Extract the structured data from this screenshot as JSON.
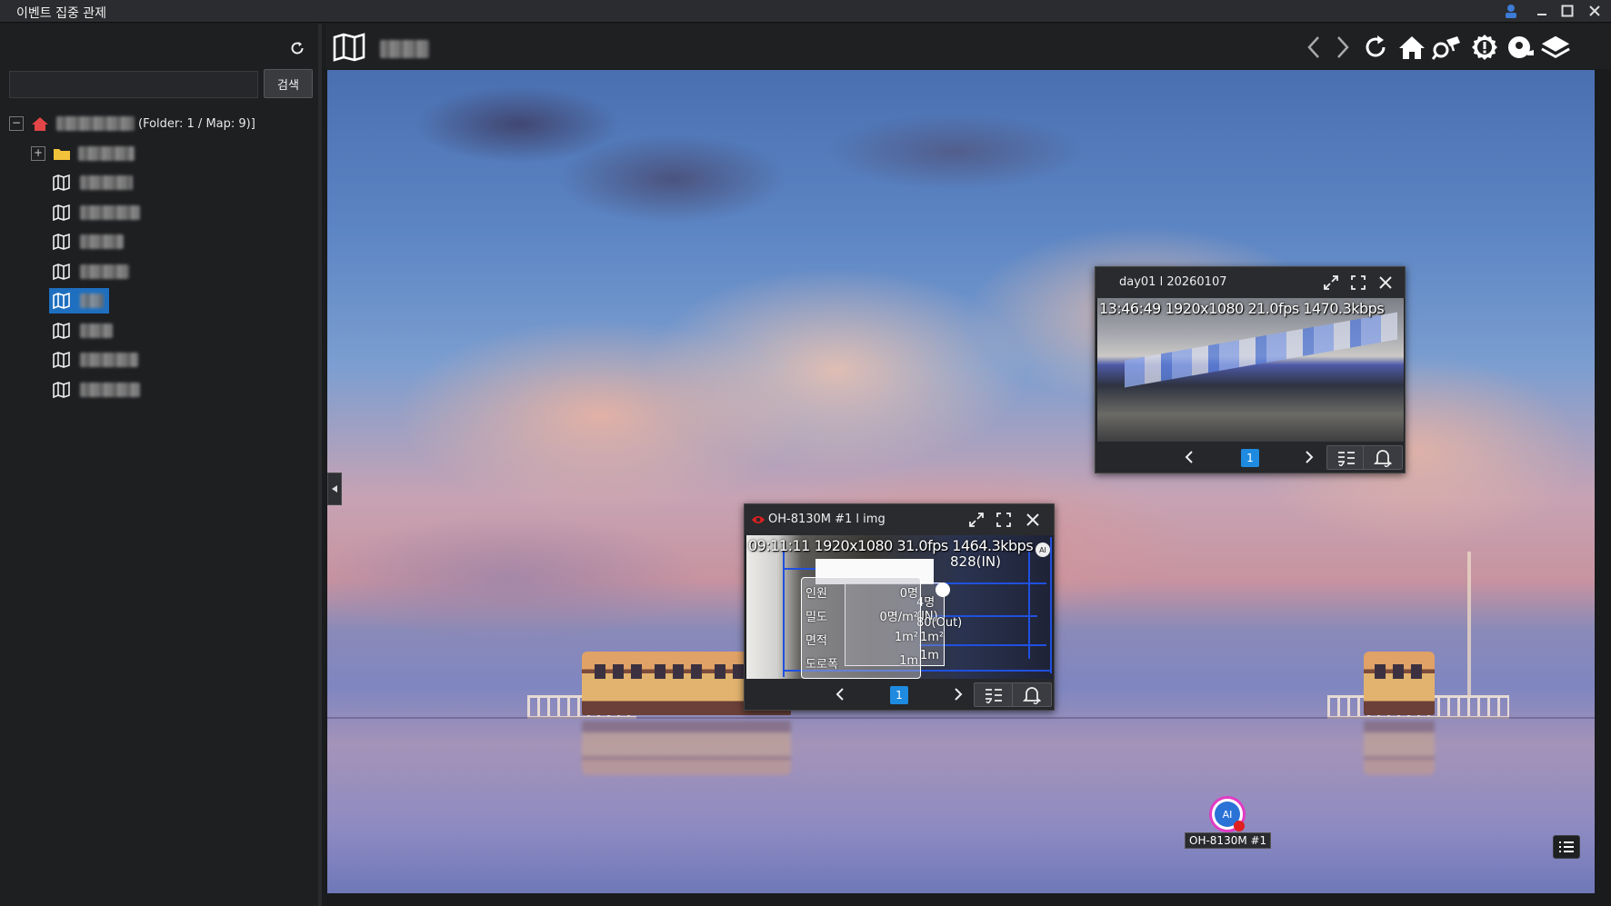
{
  "window": {
    "title": "이벤트 집중 관제"
  },
  "sidebar": {
    "search_placeholder": "",
    "search_button": "검색",
    "tree_root_suffix": "(Folder: 1 / Map: 9)]",
    "tree_items": [
      {
        "type": "site"
      },
      {
        "type": "folder"
      },
      {
        "type": "map"
      },
      {
        "type": "map"
      },
      {
        "type": "map"
      },
      {
        "type": "map"
      },
      {
        "type": "map",
        "selected": true
      },
      {
        "type": "map"
      },
      {
        "type": "map"
      },
      {
        "type": "map"
      }
    ]
  },
  "toolbar": {
    "icons": [
      "back-icon",
      "forward-icon",
      "refresh-icon",
      "home-icon",
      "search-camera-icon",
      "alert-icon",
      "camera-settings-icon",
      "layers-icon"
    ]
  },
  "popups": [
    {
      "title": "day01 l 20260107",
      "overlay": "13:46:49 1920x1080 21.0fps 1470.3kbps",
      "page": "1"
    },
    {
      "title": "OH-8130M #1 l img",
      "overlay": "09:11:11 1920x1080 31.0fps 1464.3kbps",
      "counter_in": "828(IN)",
      "analytics_rows": [
        {
          "label": "인원",
          "value": "0명"
        },
        {
          "label": "밀도",
          "value": "0명/m²"
        },
        {
          "label": "면적",
          "value": "1m²"
        },
        {
          "label": "도로폭",
          "value": "1m"
        }
      ],
      "analytics_back": {
        "in": "4명(IN)",
        "out": "80(Out)",
        "area": "1m²",
        "width": "1m"
      },
      "page": "1"
    }
  ],
  "camera_marker": {
    "label": "OH-8130M #1",
    "badge": "AI"
  },
  "colors": {
    "accent": "#1e8be0",
    "selected_tree": "#1e6fbf",
    "marker_ring": "#e23cc5",
    "status_red": "#e02020"
  }
}
